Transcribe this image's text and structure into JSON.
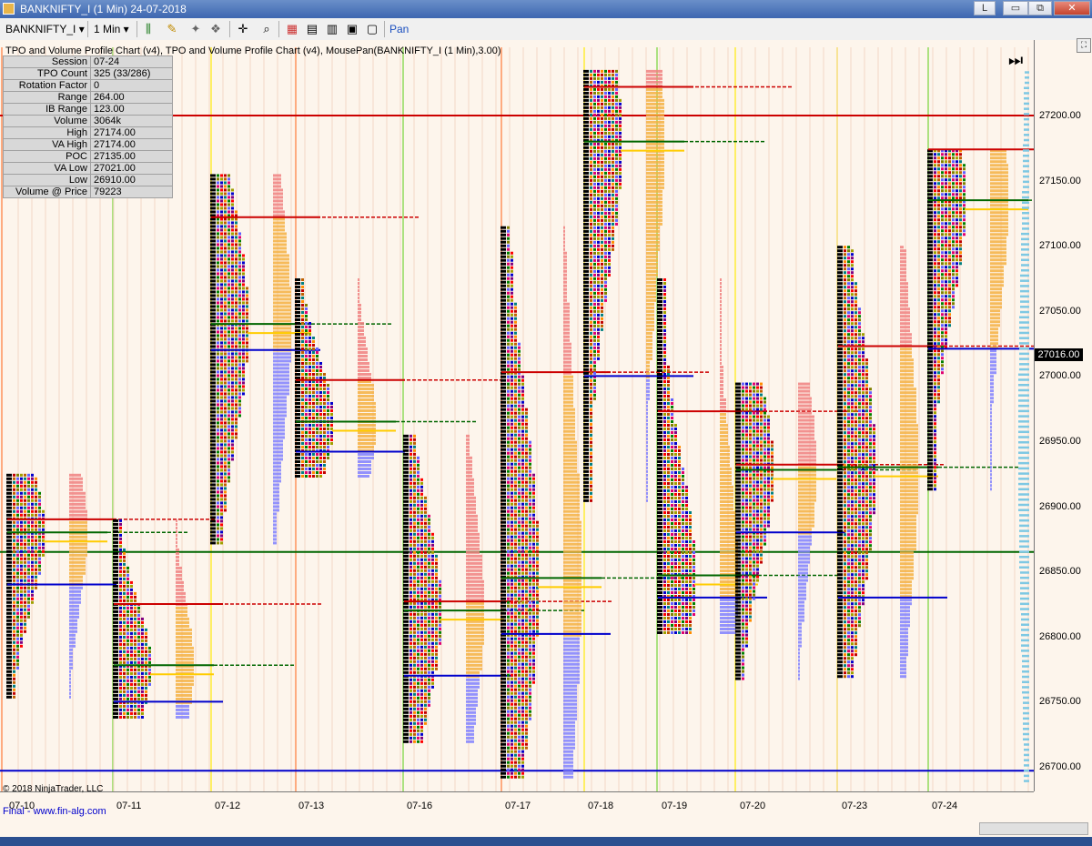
{
  "window": {
    "title": "BANKNIFTY_I (1 Min)  24-07-2018",
    "buttons": [
      "L",
      "▭",
      "⧉",
      "✕"
    ]
  },
  "toolbar": {
    "instrument": "BANKNIFTY_I",
    "interval": "1 Min",
    "pan_label": "Pan"
  },
  "chart": {
    "header": "TPO and Volume Profile Chart (v4),  TPO and Volume Profile Chart (v4), MousePan(BANKNIFTY_I (1 Min),3.00)",
    "info": [
      {
        "k": "Session",
        "v": "07-24"
      },
      {
        "k": "TPO Count",
        "v": "325 (33/286)"
      },
      {
        "k": "Rotation Factor",
        "v": "0"
      },
      {
        "k": "Range",
        "v": "264.00"
      },
      {
        "k": "IB Range",
        "v": "123.00"
      },
      {
        "k": "Volume",
        "v": "3064k"
      },
      {
        "k": "High",
        "v": "27174.00"
      },
      {
        "k": "VA High",
        "v": "27174.00"
      },
      {
        "k": "POC",
        "v": "27135.00"
      },
      {
        "k": "VA Low",
        "v": "27021.00"
      },
      {
        "k": "Low",
        "v": "26910.00"
      },
      {
        "k": "Volume @ Price",
        "v": "79223"
      }
    ],
    "current_price": "27016.00",
    "copyright": "© 2018 NinjaTrader, LLC",
    "footer": "Final - www.fin-alg.com"
  },
  "chart_data": {
    "type": "tpo-profile",
    "y_ticks": [
      "27200.00",
      "27150.00",
      "27100.00",
      "27050.00",
      "27000.00",
      "26950.00",
      "26900.00",
      "26850.00",
      "26800.00",
      "26750.00",
      "26700.00"
    ],
    "ylim": [
      26680,
      27240
    ],
    "x_ticks": [
      "07-10",
      "07-11",
      "07-12",
      "07-13",
      "07-16",
      "07-17",
      "07-18",
      "07-19",
      "07-20",
      "07-23",
      "07-24"
    ],
    "sessions": [
      {
        "date": "07-10",
        "high": 26925,
        "low": 26750,
        "poc": 26880,
        "vah": 26890,
        "val": 26840
      },
      {
        "date": "07-11",
        "high": 26890,
        "low": 26735,
        "poc": 26778,
        "vah": 26825,
        "val": 26750
      },
      {
        "date": "07-12",
        "high": 27155,
        "low": 26870,
        "poc": 27040,
        "vah": 27122,
        "val": 27020
      },
      {
        "date": "07-13",
        "high": 27075,
        "low": 26920,
        "poc": 26965,
        "vah": 26997,
        "val": 26942
      },
      {
        "date": "07-16",
        "high": 26955,
        "low": 26715,
        "poc": 26820,
        "vah": 26827,
        "val": 26770
      },
      {
        "date": "07-17",
        "high": 27115,
        "low": 26690,
        "poc": 26845,
        "vah": 27003,
        "val": 26802
      },
      {
        "date": "07-18",
        "high": 27235,
        "low": 26900,
        "poc": 27180,
        "vah": 27222,
        "val": 27000
      },
      {
        "date": "07-19",
        "high": 27075,
        "low": 26800,
        "poc": 26847,
        "vah": 26973,
        "val": 26830
      },
      {
        "date": "07-20",
        "high": 26995,
        "low": 26765,
        "poc": 26928,
        "vah": 26932,
        "val": 26880
      },
      {
        "date": "07-23",
        "high": 27100,
        "low": 26765,
        "poc": 26930,
        "vah": 27023,
        "val": 26830
      },
      {
        "date": "07-24",
        "high": 27174,
        "low": 26910,
        "poc": 27135,
        "vah": 27174,
        "val": 27021
      }
    ],
    "horizontal_lines": [
      27200,
      26865,
      26697
    ]
  }
}
